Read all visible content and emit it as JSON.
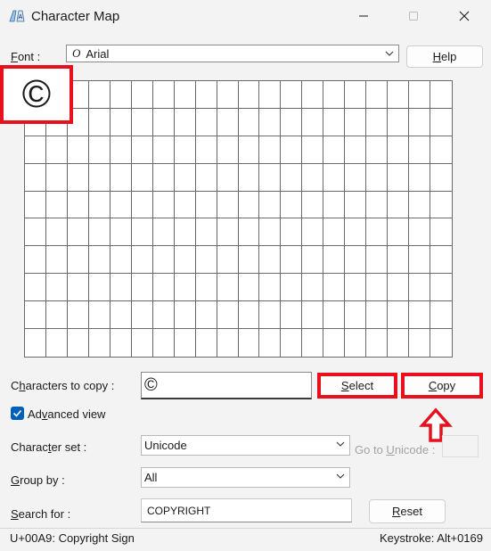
{
  "window": {
    "title": "Character Map",
    "icons": {
      "app": "character-map-icon",
      "minimize": "minimize-icon",
      "maximize": "maximize-icon",
      "close": "close-icon"
    }
  },
  "font": {
    "label_pre": "",
    "label_underlined": "F",
    "label_post": "ont :",
    "glyph": "O",
    "value": "Arial",
    "help_pre": "",
    "help_underlined": "H",
    "help_post": "elp"
  },
  "grid": {
    "columns": 20,
    "rows": 10,
    "zoomed_char": "©"
  },
  "copy": {
    "label_pre": "C",
    "label_underlined": "h",
    "label_post": "aracters to copy :",
    "value": "©",
    "select_pre": "",
    "select_underlined": "S",
    "select_post": "elect",
    "copy_pre": "",
    "copy_underlined": "C",
    "copy_post": "opy"
  },
  "advanced": {
    "checked": true,
    "label_pre": "Ad",
    "label_underlined": "v",
    "label_post": "anced view"
  },
  "charset": {
    "label_pre": "Charac",
    "label_underlined": "t",
    "label_post": "er set :",
    "value": "Unicode",
    "goto_pre": "Go to ",
    "goto_underlined": "U",
    "goto_post": "nicode :"
  },
  "groupby": {
    "label_pre": "",
    "label_underlined": "G",
    "label_post": "roup by :",
    "value": "All"
  },
  "search": {
    "label_pre": "",
    "label_underlined": "S",
    "label_post": "earch for :",
    "value": "COPYRIGHT",
    "reset_pre": "",
    "reset_underlined": "R",
    "reset_post": "eset"
  },
  "status": {
    "left": "U+00A9: Copyright Sign",
    "right": "Keystroke: Alt+0169"
  },
  "colors": {
    "highlight": "#e8101c",
    "accent": "#005fb8"
  }
}
